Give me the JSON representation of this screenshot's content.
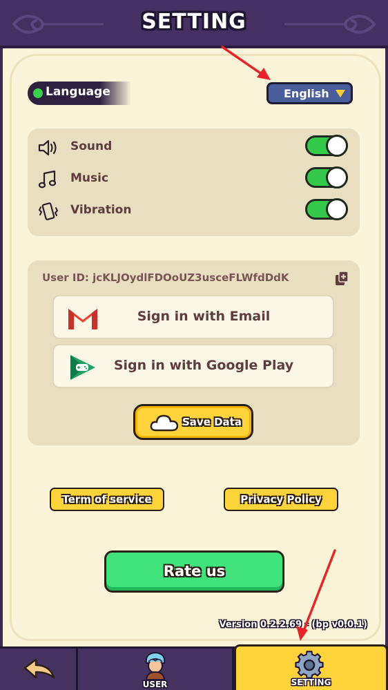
{
  "header": {
    "title": "SETTING"
  },
  "language": {
    "label": "Language",
    "selected": "English"
  },
  "audio": {
    "items": [
      {
        "label": "Sound",
        "icon": "speaker-icon",
        "enabled": true
      },
      {
        "label": "Music",
        "icon": "music-note-icon",
        "enabled": true
      },
      {
        "label": "Vibration",
        "icon": "vibration-icon",
        "enabled": true
      }
    ]
  },
  "account": {
    "user_id": "User ID: jcKLJOydlFDOoUZ3usceFLWfdDdK",
    "email_label": "Sign in with Email",
    "google_label": "Sign in with Google Play",
    "save_label": "Save Data"
  },
  "links": {
    "terms": "Term of service",
    "privacy": "Privacy Policy"
  },
  "rate_label": "Rate us",
  "version": "Version 0.2.2.69 - (bp v0.0.1)",
  "nav": {
    "user": "USER",
    "setting": "SETTING"
  },
  "colors": {
    "header_bg": "#453063",
    "panel_bg": "#f9f3d7",
    "toggle_on": "#35c94a",
    "button_yellow": "#ffd43b",
    "rate_green": "#3fe37a",
    "select_blue": "#4a5e9c",
    "annotation_red": "#e8232a"
  }
}
